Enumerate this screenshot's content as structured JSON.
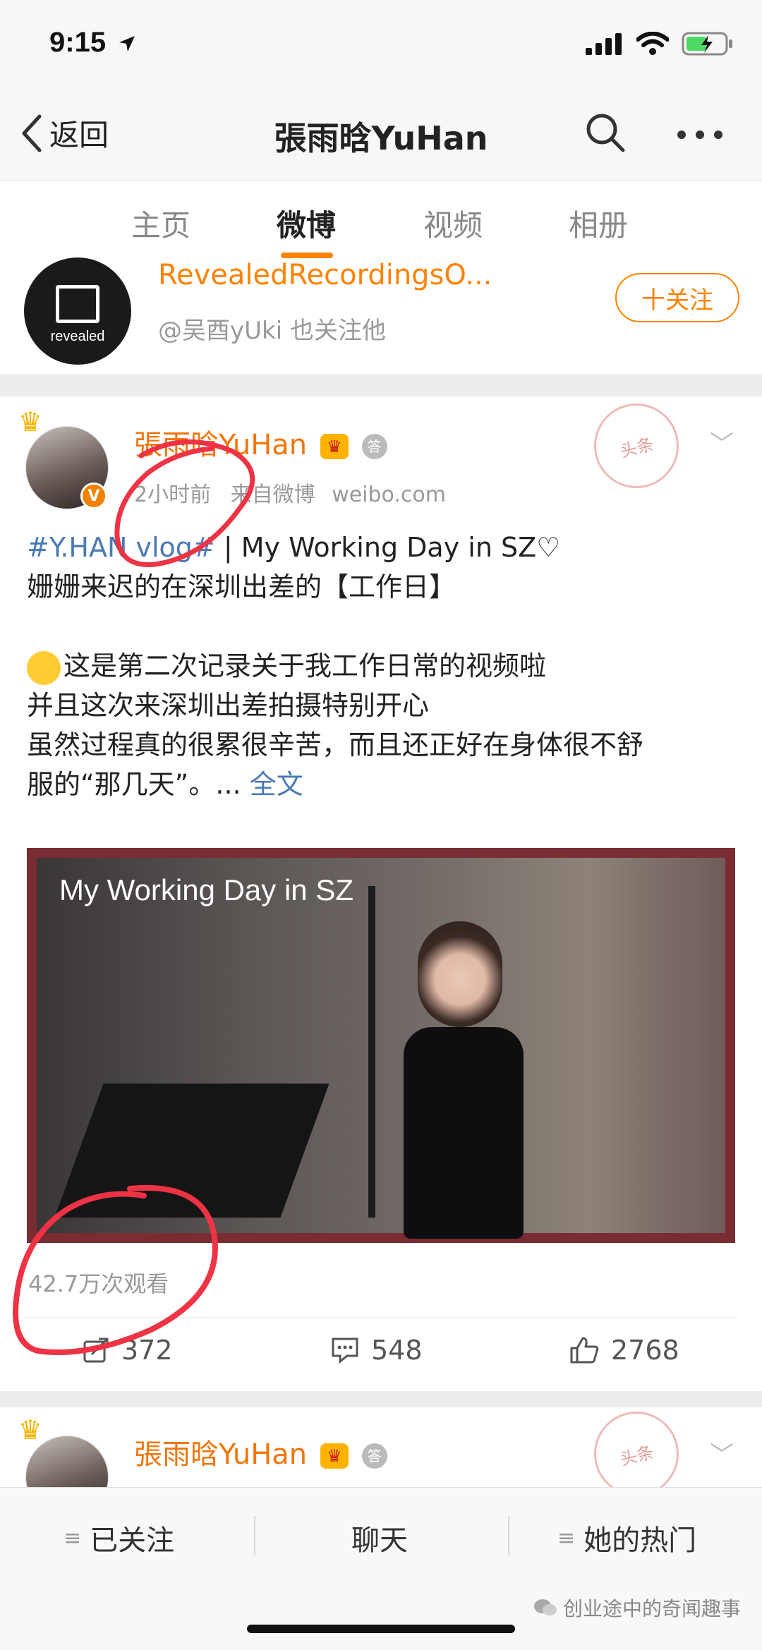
{
  "status_bar": {
    "time": "9:15"
  },
  "nav": {
    "back_label": "返回",
    "title": "張雨晗YuHan"
  },
  "tabs": [
    {
      "label": "主页"
    },
    {
      "label": "微博"
    },
    {
      "label": "视频"
    },
    {
      "label": "相册"
    }
  ],
  "recommend": {
    "logo_text": "revealed",
    "name": "RevealedRecordingsO...",
    "subtitle": "@吴酉yUki 也关注他",
    "follow_label": "十关注"
  },
  "post": {
    "author": "張雨晗YuHan",
    "badge_crown": "👑",
    "badge_medal": "答",
    "time": "2小时前",
    "source": "来自微博",
    "source_site": "weibo.com",
    "stamp_text": "头条",
    "hashtag": "#Y.HAN vlog#",
    "title_line": " | My Working Day in SZ♡",
    "line2": "姗姗来迟的在深圳出差的【工作日】",
    "line3": "这是第二次记录关于我工作日常的视频啦",
    "line4": "并且这次来深圳出差拍摄特别开心",
    "line5": "虽然过程真的很累很辛苦，而且还正好在身体很不舒",
    "line6": "服的“那几天”。... ",
    "more_label": "全文",
    "video_title": "My Working Day in SZ",
    "views": "42.7万次观看",
    "reposts": "372",
    "comments": "548",
    "likes": "2768"
  },
  "post2": {
    "author": "張雨晗YuHan",
    "stamp_text": "头条"
  },
  "bottom_bar": {
    "following_label": "已关注",
    "chat_label": "聊天",
    "hot_label": "她的热门",
    "watermark": "创业途中的奇闻趣事"
  },
  "colors": {
    "accent": "#ff8200",
    "link": "#4a7ab5",
    "annotation": "#ee3344"
  }
}
